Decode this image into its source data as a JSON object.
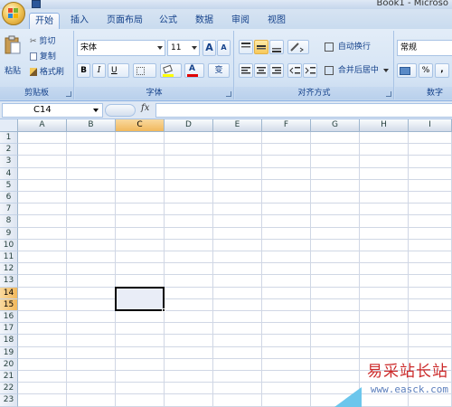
{
  "window": {
    "title": "Book1 - Microso"
  },
  "tabs": [
    {
      "label": "开始",
      "active": true
    },
    {
      "label": "插入"
    },
    {
      "label": "页面布局"
    },
    {
      "label": "公式"
    },
    {
      "label": "数据"
    },
    {
      "label": "审阅"
    },
    {
      "label": "视图"
    }
  ],
  "ribbon": {
    "clipboard": {
      "paste_label": "粘贴",
      "cut_label": "剪切",
      "copy_label": "复制",
      "format_painter_label": "格式刷",
      "group_label": "剪贴板"
    },
    "font": {
      "font_name": "宋体",
      "font_size": "11",
      "bold": "B",
      "italic": "I",
      "underline": "U",
      "font_color_glyph": "A",
      "phonetic_glyph": "变",
      "grow_glyph": "A",
      "shrink_glyph": "A",
      "group_label": "字体"
    },
    "alignment": {
      "wrap_text_label": "自动换行",
      "merge_center_label": "合并后居中",
      "group_label": "对齐方式"
    },
    "number": {
      "format_value": "常规",
      "percent_glyph": "%",
      "comma_glyph": ",",
      "group_label": "数字"
    }
  },
  "formula_bar": {
    "name_box": "C14",
    "fx_label": "fx",
    "formula": ""
  },
  "grid": {
    "columns": [
      "A",
      "B",
      "C",
      "D",
      "E",
      "F",
      "G",
      "H",
      "I"
    ],
    "rows": [
      "1",
      "2",
      "3",
      "4",
      "5",
      "6",
      "7",
      "8",
      "9",
      "10",
      "11",
      "12",
      "13",
      "14",
      "15",
      "16",
      "17",
      "18",
      "19",
      "20",
      "21",
      "22",
      "23"
    ],
    "active_column": "C",
    "active_rows": [
      "14",
      "15"
    ],
    "selected_cell": "C14"
  },
  "watermark": {
    "title": "易采站长站",
    "url": "www.easck.com"
  },
  "colors": {
    "ribbon_text": "#15428b",
    "header_active": "#f1b85c",
    "watermark_red": "#cc2a2a",
    "watermark_blue": "#5c7fbd"
  }
}
